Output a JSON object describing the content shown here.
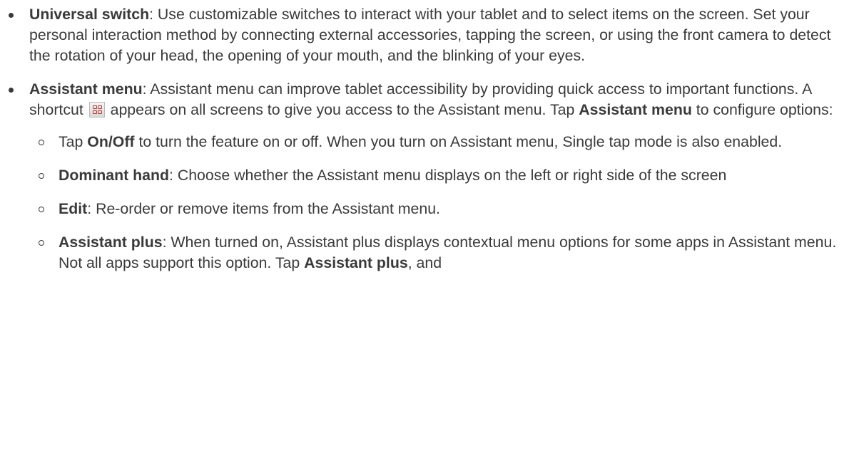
{
  "items": [
    {
      "term": "Universal switch",
      "text": ": Use customizable switches to interact with your tablet and to select items on the screen. Set your personal interaction method by connecting external accessories, tapping the screen, or using the front camera to detect the rotation of your head, the opening of your mouth, and the blinking of your eyes."
    },
    {
      "term": "Assistant menu",
      "text_before_icon": ": Assistant menu can improve tablet accessibility by providing quick access to important functions. A shortcut",
      "icon": "assistant-menu-shortcut-icon",
      "text_after_icon": "appears on all screens to give you access to the Assistant menu. Tap",
      "term_inline": "Assistant menu",
      "text_end": "to configure options:"
    }
  ],
  "sub_items": [
    {
      "prefix": "Tap",
      "term": "On/Off",
      "text": "to turn the feature on or off. When you turn on Assistant menu, Single tap mode is also enabled."
    },
    {
      "term": "Dominant hand",
      "text": ": Choose whether the Assistant menu displays on the left or right side of the screen"
    },
    {
      "term": "Edit",
      "text": ": Re-order or remove items from the Assistant menu."
    },
    {
      "term": "Assistant plus",
      "text": ": When turned on, Assistant plus displays contextual menu options for some apps in Assistant menu. Not all apps support this option. Tap",
      "term_inline": "Assistant plus",
      "text_end": ", and"
    }
  ],
  "colors": {
    "text": "#3a3a3a",
    "icon_accent": "#c0392b"
  }
}
